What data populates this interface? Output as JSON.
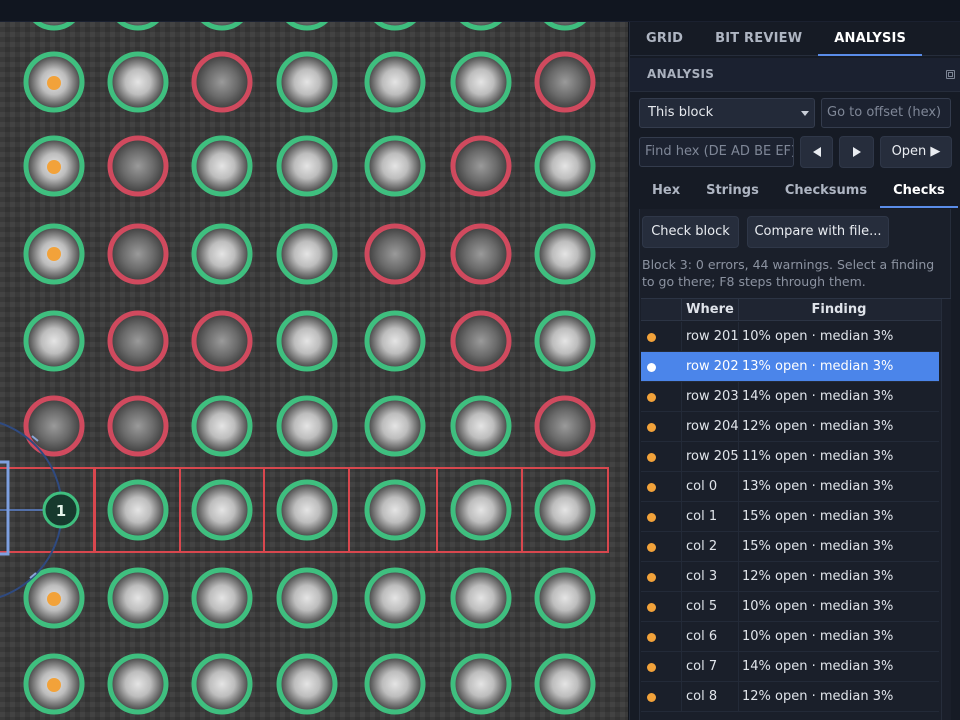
{
  "main_tabs": [
    {
      "label": "GRID",
      "active": false
    },
    {
      "label": "BIT REVIEW",
      "active": false
    },
    {
      "label": "ANALYSIS",
      "active": true
    }
  ],
  "panel": {
    "title": "ANALYSIS",
    "scope_select": "This block",
    "offset_placeholder": "Go to offset (hex)",
    "find_placeholder": "Find hex (DE AD BE EF)...",
    "open_label": "Open ▶"
  },
  "sub_tabs": [
    {
      "label": "Hex",
      "active": false
    },
    {
      "label": "Strings",
      "active": false
    },
    {
      "label": "Checksums",
      "active": false
    },
    {
      "label": "Checks",
      "active": true
    }
  ],
  "checks": {
    "check_block_label": "Check block",
    "compare_label": "Compare with file...",
    "summary": "Block 3: 0 errors, 44 warnings. Select a finding to go there; F8 steps through them.",
    "columns": {
      "where": "Where",
      "finding": "Finding"
    },
    "findings": [
      {
        "where": "row 201",
        "finding": "10% open · median 3%",
        "selected": false
      },
      {
        "where": "row 202",
        "finding": "13% open · median 3%",
        "selected": true
      },
      {
        "where": "row 203",
        "finding": "14% open · median 3%",
        "selected": false
      },
      {
        "where": "row 204",
        "finding": "12% open · median 3%",
        "selected": false
      },
      {
        "where": "row 205",
        "finding": "11% open · median 3%",
        "selected": false
      },
      {
        "where": "col 0",
        "finding": "13% open · median 3%",
        "selected": false
      },
      {
        "where": "col 1",
        "finding": "15% open · median 3%",
        "selected": false
      },
      {
        "where": "col 2",
        "finding": "15% open · median 3%",
        "selected": false
      },
      {
        "where": "col 3",
        "finding": "12% open · median 3%",
        "selected": false
      },
      {
        "where": "col 5",
        "finding": "10% open · median 3%",
        "selected": false
      },
      {
        "where": "col 6",
        "finding": "10% open · median 3%",
        "selected": false
      },
      {
        "where": "col 7",
        "finding": "14% open · median 3%",
        "selected": false
      },
      {
        "where": "col 8",
        "finding": "12% open · median 3%",
        "selected": false
      }
    ]
  },
  "viewer": {
    "marker_label": "1",
    "colors": {
      "bit_on": "#3fbf7f",
      "bit_off": "#d04a5e",
      "warning_dot": "#f2a23a",
      "selection": "#d8474e"
    },
    "grid": [
      [
        "on",
        "on",
        "off",
        "on",
        "on",
        "on",
        "off"
      ],
      [
        "on",
        "off",
        "on",
        "on",
        "on",
        "off",
        "on"
      ],
      [
        "on",
        "off",
        "on",
        "on",
        "off",
        "off",
        "on"
      ],
      [
        "on",
        "off",
        "off",
        "on",
        "on",
        "off",
        "on"
      ],
      [
        "off",
        "off",
        "on",
        "on",
        "on",
        "on",
        "off"
      ],
      [
        "on",
        "on",
        "on",
        "on",
        "on",
        "on",
        "on"
      ],
      [
        "on",
        "on",
        "on",
        "on",
        "on",
        "on",
        "on"
      ],
      [
        "on",
        "on",
        "on",
        "on",
        "on",
        "on",
        "on"
      ]
    ],
    "warning_rows": [
      0,
      1,
      2,
      6,
      7
    ]
  }
}
